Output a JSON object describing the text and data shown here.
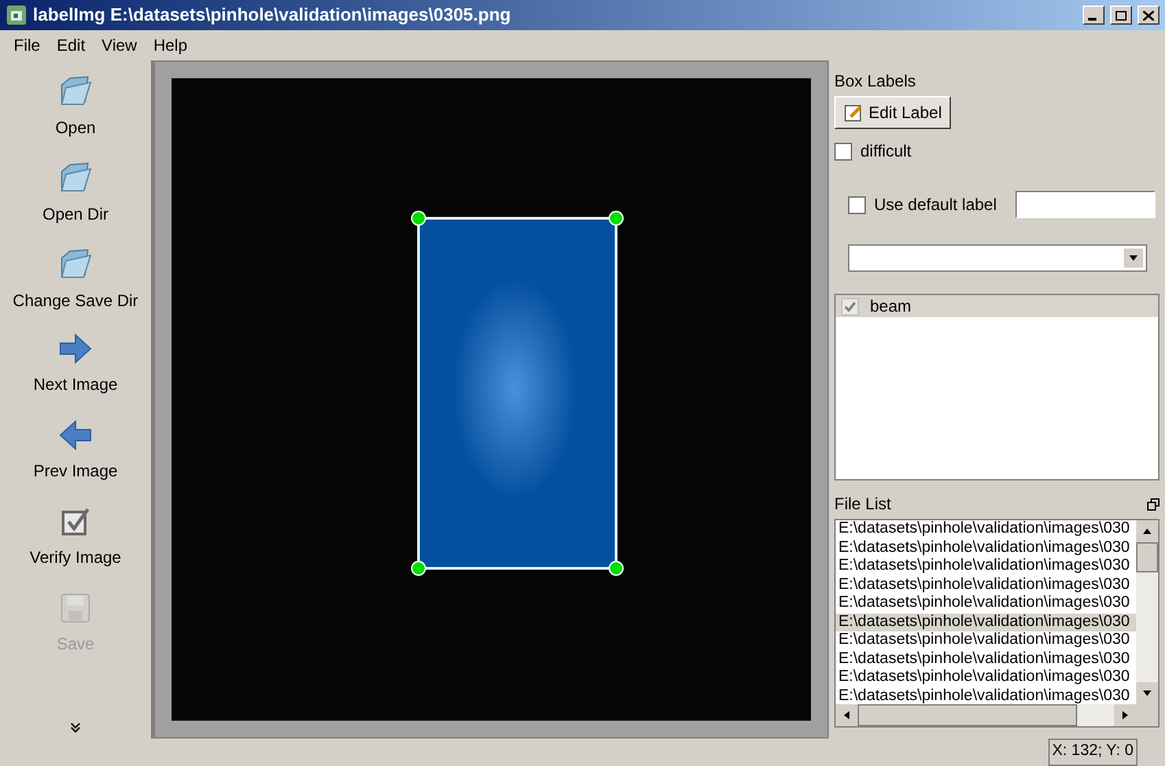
{
  "window": {
    "title": "labelImg E:\\datasets\\pinhole\\validation\\images\\0305.png"
  },
  "menu": [
    "File",
    "Edit",
    "View",
    "Help"
  ],
  "toolbar": [
    {
      "label": "Open",
      "kind": "folder",
      "disabled": false
    },
    {
      "label": "Open Dir",
      "kind": "folder",
      "disabled": false
    },
    {
      "label": "Change Save Dir",
      "kind": "folder",
      "disabled": false
    },
    {
      "label": "Next Image",
      "kind": "next",
      "disabled": false
    },
    {
      "label": "Prev Image",
      "kind": "prev",
      "disabled": false
    },
    {
      "label": "Verify Image",
      "kind": "verify",
      "disabled": false
    },
    {
      "label": "Save",
      "kind": "save",
      "disabled": true
    }
  ],
  "box_labels": {
    "title": "Box Labels",
    "edit_button": "Edit Label",
    "difficult": {
      "label": "difficult",
      "checked": false
    },
    "use_default_label": {
      "label": "Use default label",
      "checked": false
    },
    "labels": [
      {
        "label": "beam",
        "checked": true,
        "selected": true
      }
    ]
  },
  "file_list": {
    "title": "File List",
    "items": [
      {
        "path": "E:\\datasets\\pinhole\\validation\\images\\030",
        "selected": false
      },
      {
        "path": "E:\\datasets\\pinhole\\validation\\images\\030",
        "selected": false
      },
      {
        "path": "E:\\datasets\\pinhole\\validation\\images\\030",
        "selected": false
      },
      {
        "path": "E:\\datasets\\pinhole\\validation\\images\\030",
        "selected": false
      },
      {
        "path": "E:\\datasets\\pinhole\\validation\\images\\030",
        "selected": false
      },
      {
        "path": "E:\\datasets\\pinhole\\validation\\images\\030",
        "selected": true
      },
      {
        "path": "E:\\datasets\\pinhole\\validation\\images\\030",
        "selected": false
      },
      {
        "path": "E:\\datasets\\pinhole\\validation\\images\\030",
        "selected": false
      },
      {
        "path": "E:\\datasets\\pinhole\\validation\\images\\030",
        "selected": false
      },
      {
        "path": "E:\\datasets\\pinhole\\validation\\images\\030",
        "selected": false
      }
    ]
  },
  "status_bar": "X: 132; Y: 0"
}
